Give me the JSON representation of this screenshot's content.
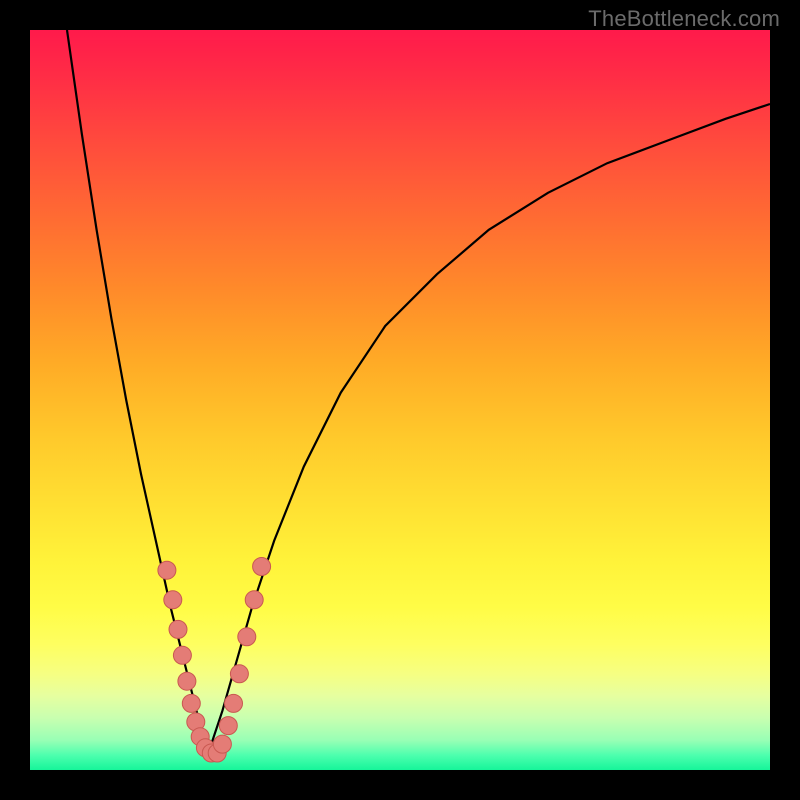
{
  "watermark": "TheBottleneck.com",
  "colors": {
    "curve_stroke": "#000000",
    "marker_fill": "#e47c76",
    "marker_stroke": "#c95851"
  },
  "chart_data": {
    "type": "line",
    "title": "",
    "xlabel": "",
    "ylabel": "",
    "xlim": [
      0,
      100
    ],
    "ylim": [
      0,
      100
    ],
    "series": [
      {
        "name": "left-branch",
        "x": [
          5,
          7,
          9,
          11,
          13,
          15,
          17,
          19,
          20,
          21,
          22,
          23,
          24
        ],
        "y": [
          100,
          86,
          73,
          61,
          50,
          40,
          31,
          22,
          18,
          14,
          10,
          6,
          2
        ]
      },
      {
        "name": "right-branch",
        "x": [
          24,
          26,
          28,
          30,
          33,
          37,
          42,
          48,
          55,
          62,
          70,
          78,
          86,
          94,
          100
        ],
        "y": [
          2,
          8,
          15,
          22,
          31,
          41,
          51,
          60,
          67,
          73,
          78,
          82,
          85,
          88,
          90
        ]
      }
    ],
    "markers": {
      "name": "sample-points",
      "points": [
        {
          "x": 18.5,
          "y": 27
        },
        {
          "x": 19.3,
          "y": 23
        },
        {
          "x": 20.0,
          "y": 19
        },
        {
          "x": 20.6,
          "y": 15.5
        },
        {
          "x": 21.2,
          "y": 12
        },
        {
          "x": 21.8,
          "y": 9
        },
        {
          "x": 22.4,
          "y": 6.5
        },
        {
          "x": 23.0,
          "y": 4.5
        },
        {
          "x": 23.7,
          "y": 3
        },
        {
          "x": 24.5,
          "y": 2.3
        },
        {
          "x": 25.3,
          "y": 2.3
        },
        {
          "x": 26.0,
          "y": 3.5
        },
        {
          "x": 26.8,
          "y": 6
        },
        {
          "x": 27.5,
          "y": 9
        },
        {
          "x": 28.3,
          "y": 13
        },
        {
          "x": 29.3,
          "y": 18
        },
        {
          "x": 30.3,
          "y": 23
        },
        {
          "x": 31.3,
          "y": 27.5
        }
      ]
    }
  }
}
